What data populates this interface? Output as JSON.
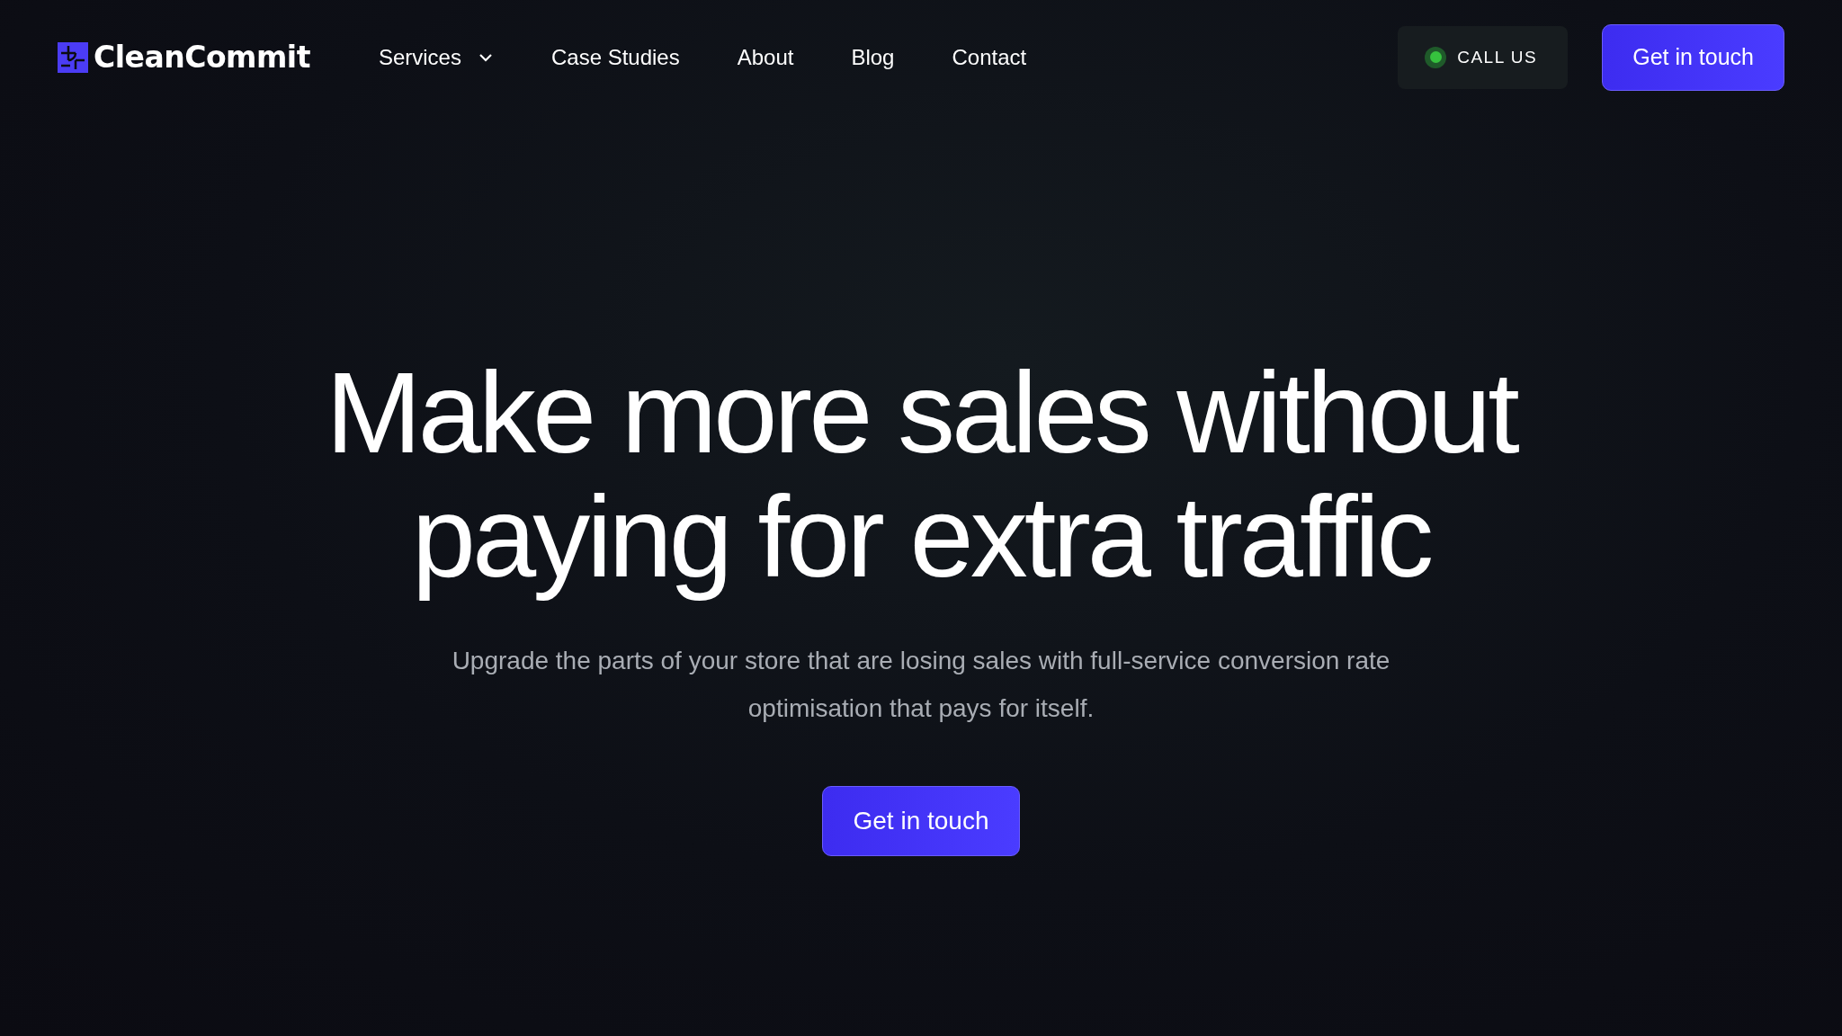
{
  "brand": {
    "name": "CleanCommit"
  },
  "nav": [
    {
      "label": "Services",
      "kind": "dropdown"
    },
    {
      "label": "Case Studies",
      "kind": "link"
    },
    {
      "label": "About",
      "kind": "link"
    },
    {
      "label": "Blog",
      "kind": "link"
    },
    {
      "label": "Contact",
      "kind": "link"
    }
  ],
  "call_button": {
    "label": "CALL US"
  },
  "header_cta": {
    "label": "Get in touch"
  },
  "hero": {
    "headline_lines": [
      "Make more sales without",
      "paying for extra traffic"
    ],
    "subtitle": "Upgrade the parts of your store that are losing sales with full-service conversion rate optimisation that pays for itself.",
    "cta": "Get in touch"
  }
}
